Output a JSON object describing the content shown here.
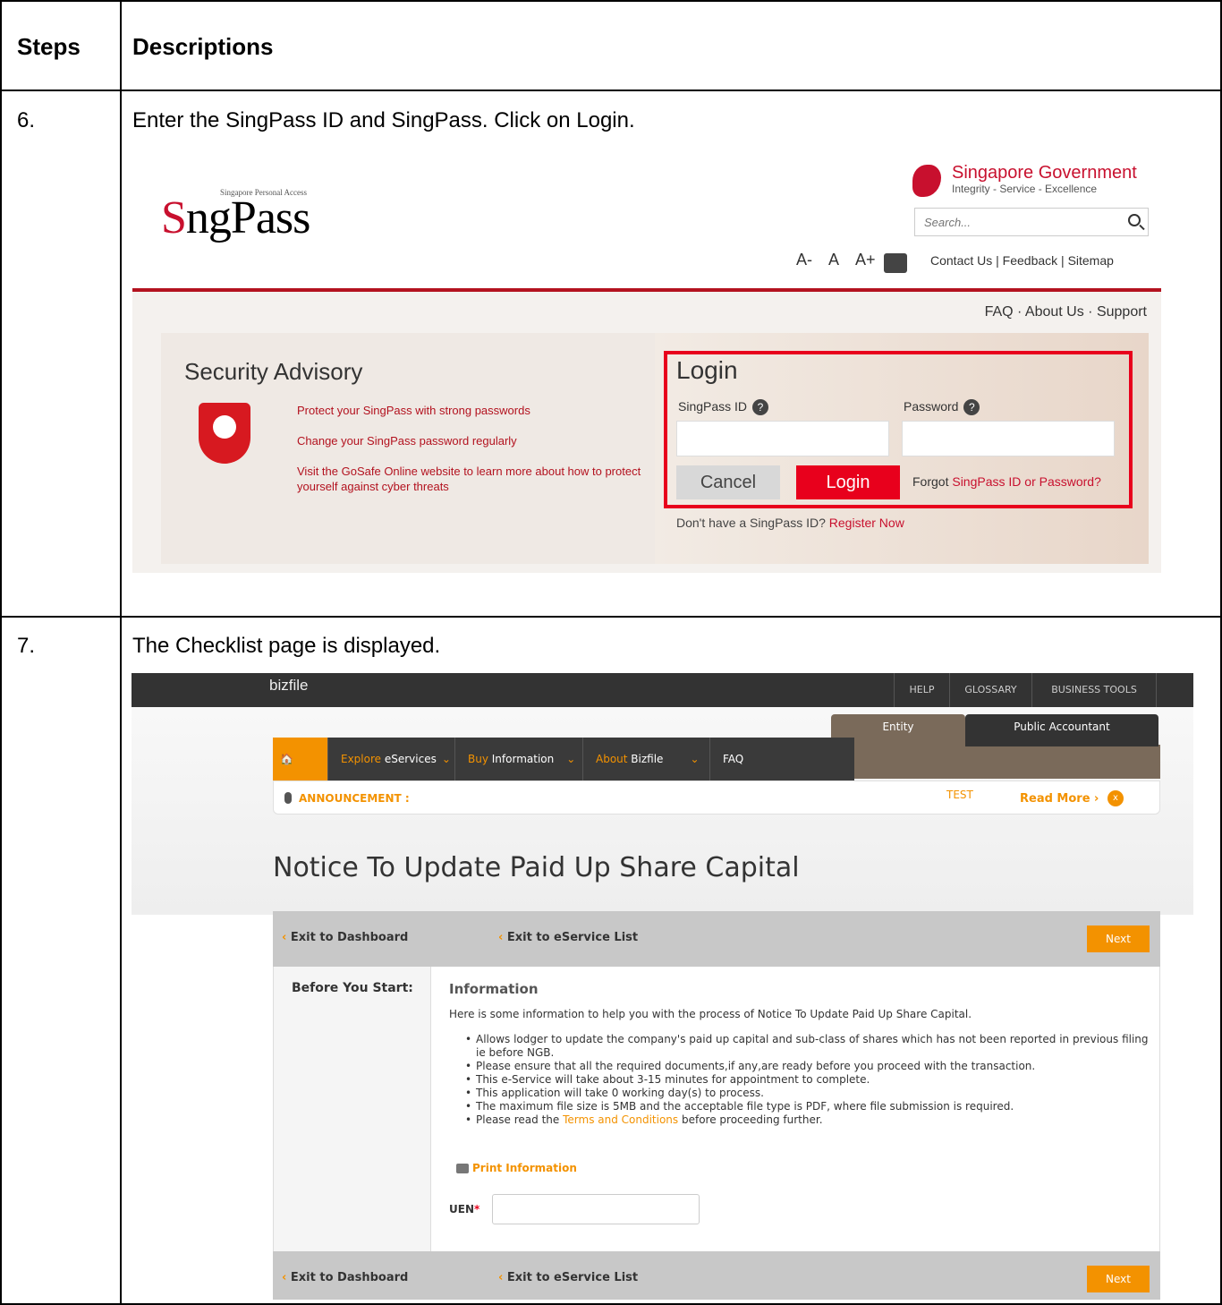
{
  "table": {
    "header_steps": "Steps",
    "header_descriptions": "Descriptions",
    "row6_step": "6.",
    "row6_text": "Enter the SingPass ID and SingPass. Click on Login.",
    "row7_step": "7.",
    "row7_text": "The Checklist page is displayed."
  },
  "singpass": {
    "logo_small": "Singapore Personal Access",
    "logo_s": "S",
    "logo_rest": "ngPass",
    "gov_title": "Singapore Government",
    "gov_sub": "Integrity - Service - Excellence",
    "search_placeholder": "Search...",
    "font_small": "A-",
    "font_normal": "A",
    "font_large": "A+",
    "top_links": "Contact Us | Feedback | Sitemap",
    "sub_nav": "FAQ  ·  About Us  ·  Support",
    "advisory_title": "Security Advisory",
    "advisory_1": "Protect your SingPass with strong passwords",
    "advisory_2": "Change your SingPass password regularly",
    "advisory_3": "Visit the GoSafe Online website to learn more about how to protect yourself against cyber threats",
    "login_title": "Login",
    "id_label": "SingPass ID",
    "password_label": "Password",
    "help_glyph": "?",
    "cancel": "Cancel",
    "login": "Login",
    "forgot_prefix": "Forgot ",
    "forgot_link": "SingPass ID or Password?",
    "register_prefix": "Don't have a SingPass ID? ",
    "register_link": "Register Now",
    "accent": "#e8001c"
  },
  "bizfile": {
    "brand": "bizfile",
    "top_links": [
      "HELP",
      "GLOSSARY",
      "BUSINESS TOOLS"
    ],
    "tab_entity": "Entity",
    "tab_public_accountant": "Public Accountant",
    "nav_home": "🏠 Home",
    "nav_explore_o": "Explore ",
    "nav_explore": "eServices",
    "nav_buy_o": "Buy ",
    "nav_buy": "Information",
    "nav_about_o": "About ",
    "nav_about": "Bizfile",
    "nav_faq": "FAQ",
    "announcement_label": "ANNOUNCEMENT :",
    "announcement_text": "TEST",
    "read_more": "Read More ›",
    "close_glyph": "x",
    "page_title": "Notice To Update Paid Up Share Capital",
    "exit_dashboard": "Exit to Dashboard",
    "exit_service_list": "Exit to eService List",
    "back_chevron": "‹ ",
    "next": "Next",
    "before_you_start": "Before You Start:",
    "info_title": "Information",
    "info_intro": "Here is some information to help you with the process of Notice To Update Paid Up Share Capital.",
    "info_items": [
      "Allows lodger to update the company's paid up capital and sub-class of shares which has not been reported in previous filing ie before NGB.",
      "Please ensure that all the required documents,if any,are ready before you proceed with the transaction.",
      "This e-Service will take about 3-15 minutes for appointment to complete.",
      "This application will take 0 working day(s) to process.",
      "The maximum file size is 5MB and the acceptable file type is PDF, where file submission is required."
    ],
    "terms_prefix": "Please read the ",
    "terms_link": "Terms and Conditions",
    "terms_suffix": " before proceeding further.",
    "print_info": "Print Information",
    "uen_label": "UEN",
    "required_mark": "*",
    "accent": "#f39200"
  }
}
